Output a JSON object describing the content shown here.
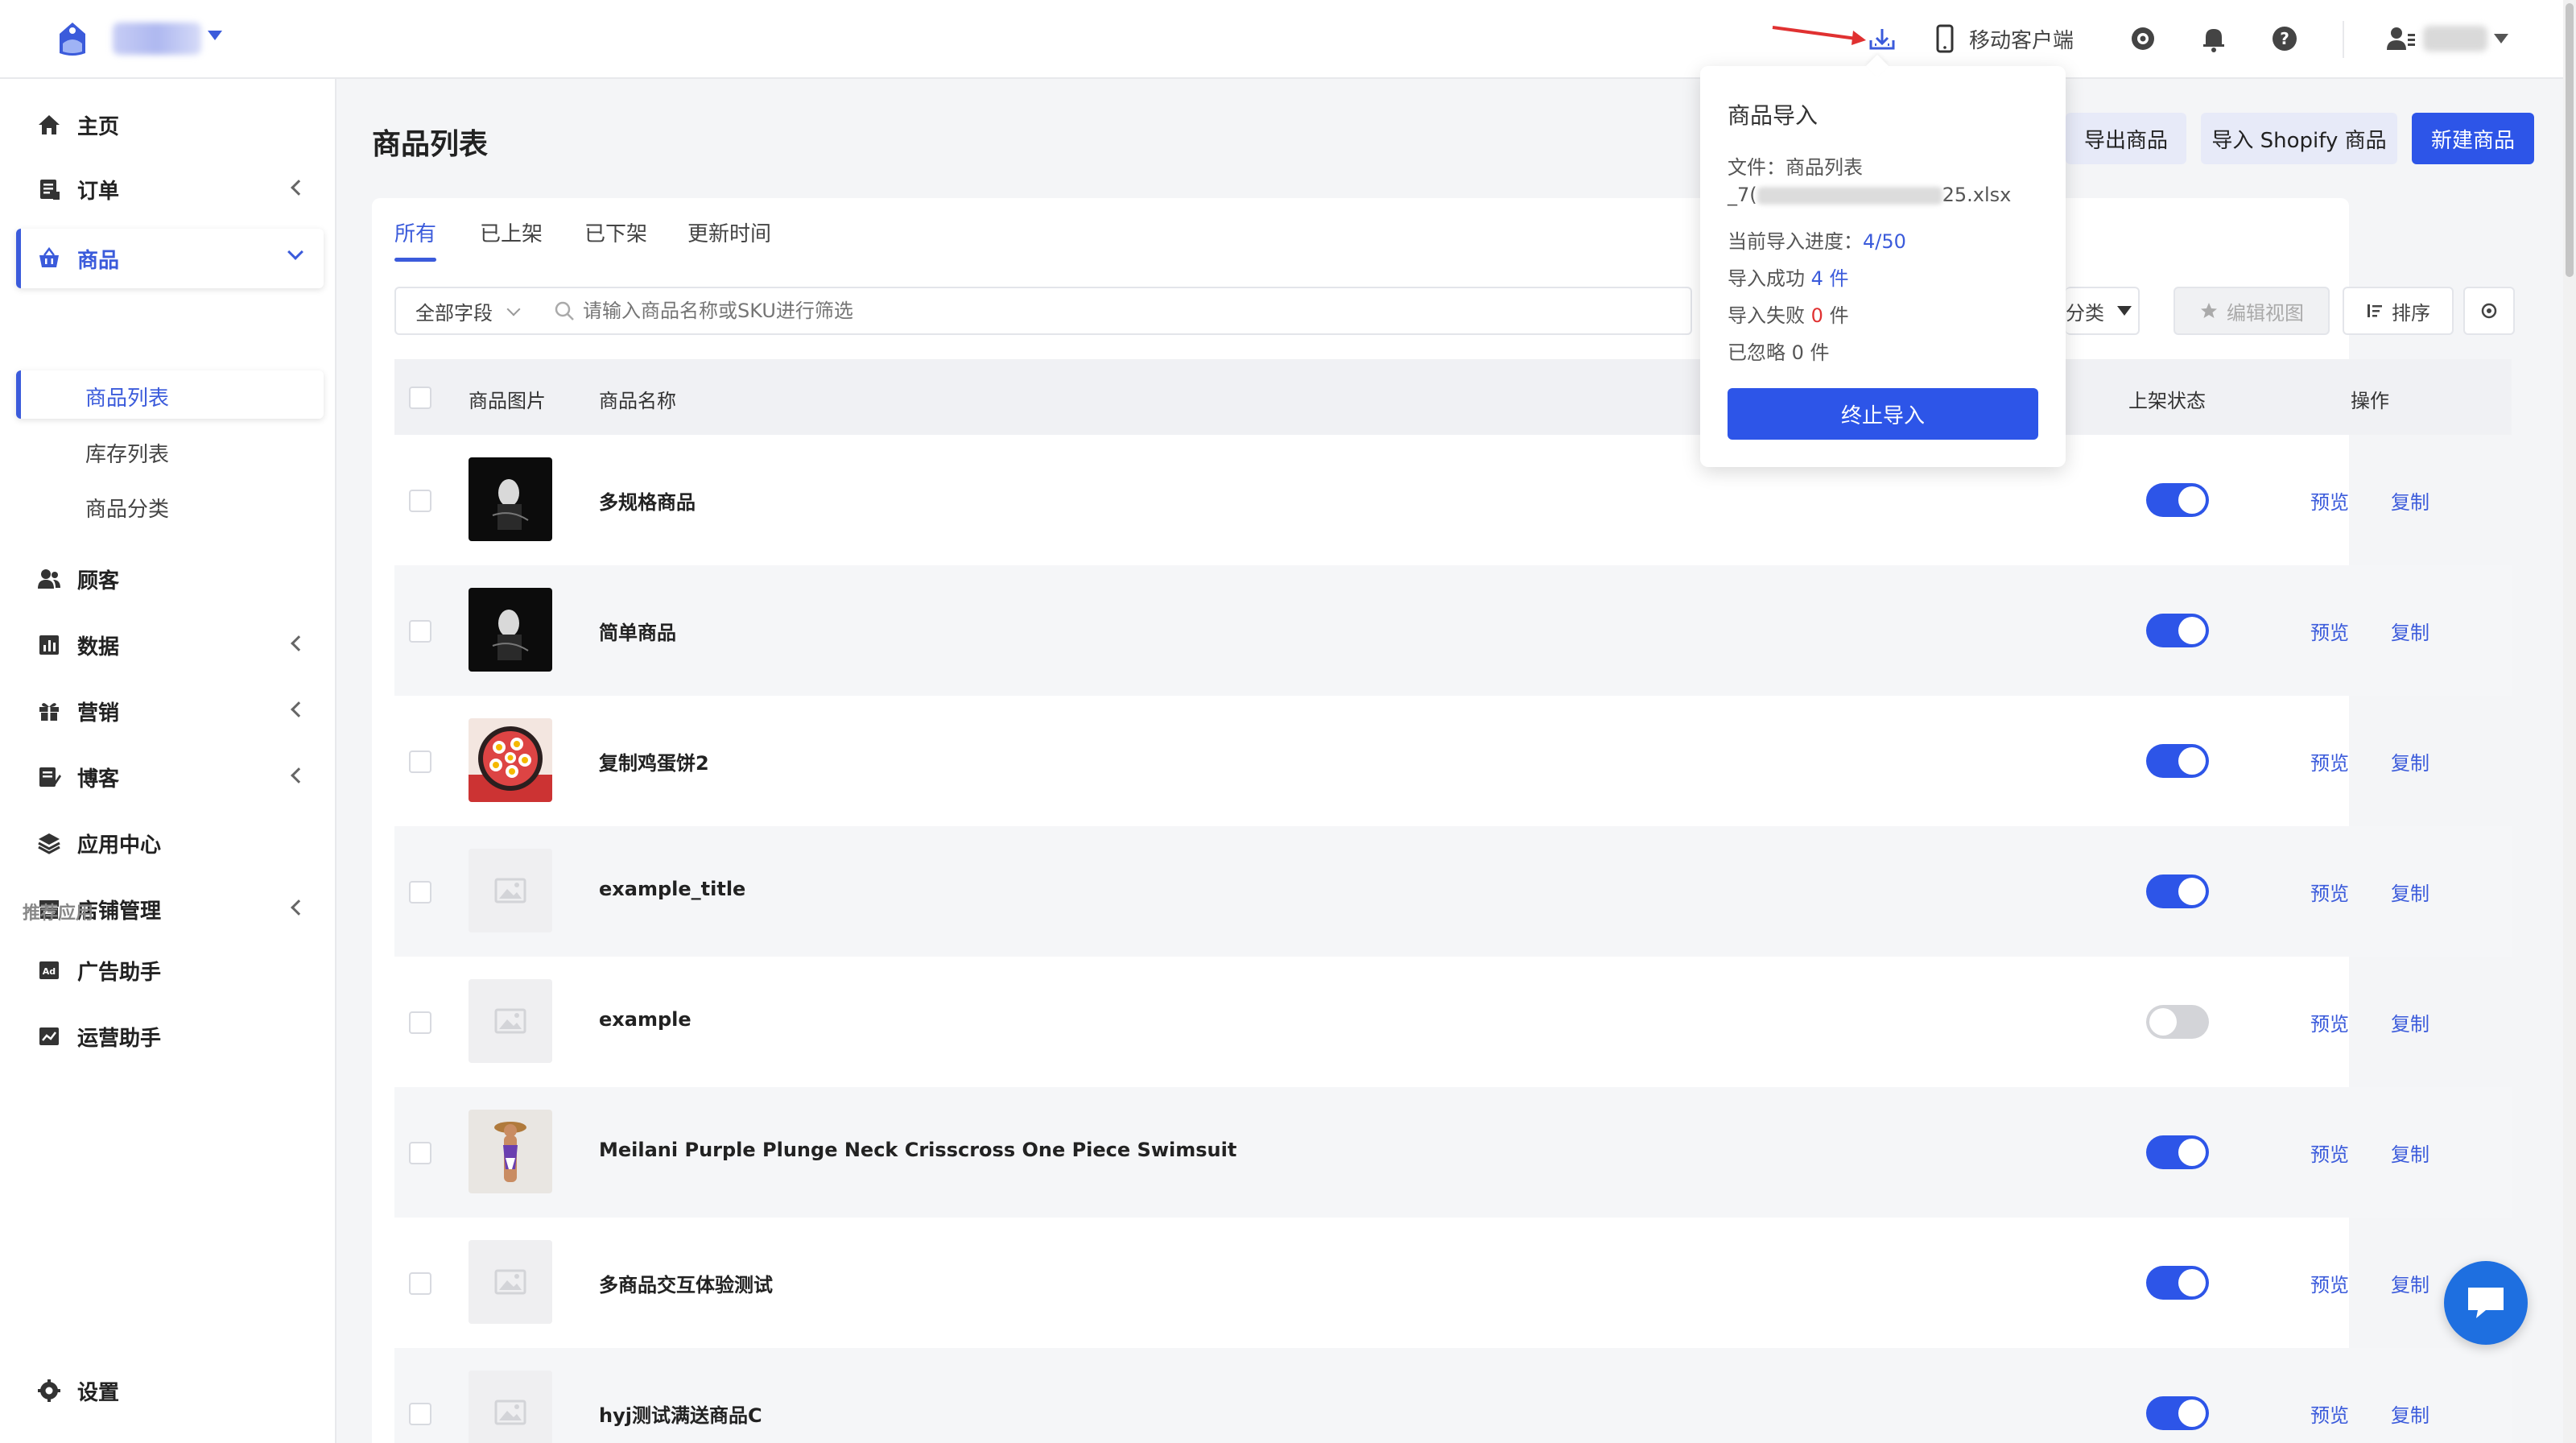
{
  "topbar": {
    "mobile_client_label": "移动客户端"
  },
  "sidebar": {
    "items": [
      {
        "label": "主页",
        "icon": "home-icon"
      },
      {
        "label": "订单",
        "icon": "order-icon"
      },
      {
        "label": "商品",
        "icon": "basket-icon"
      },
      {
        "label": "顾客",
        "icon": "customers-icon"
      },
      {
        "label": "数据",
        "icon": "chart-icon"
      },
      {
        "label": "营销",
        "icon": "gift-icon"
      },
      {
        "label": "博客",
        "icon": "blog-icon"
      },
      {
        "label": "应用中心",
        "icon": "layers-icon"
      },
      {
        "label": "店铺管理",
        "icon": "store-icon"
      }
    ],
    "sub_items": [
      "商品列表",
      "库存列表",
      "商品分类"
    ],
    "section_label": "推荐应用",
    "apps": [
      {
        "label": "广告助手",
        "icon": "ad-icon"
      },
      {
        "label": "运营助手",
        "icon": "trend-icon"
      }
    ],
    "settings_label": "设置"
  },
  "main": {
    "title": "商品列表",
    "buttons": {
      "export": "导出商品",
      "import_shopify": "导入 Shopify 商品",
      "new_product": "新建商品"
    },
    "tabs": [
      "所有",
      "已上架",
      "已下架",
      "更新时间"
    ],
    "filter": {
      "field_select": "全部字段",
      "search_placeholder": "请输入商品名称或SKU进行筛选",
      "category_partial": "分类",
      "edit_view": "编辑视图",
      "sort": "排序"
    },
    "table": {
      "headers": [
        "商品图片",
        "商品名称",
        "上架状态",
        "操作"
      ],
      "op_preview": "预览",
      "op_copy": "复制",
      "rows": [
        {
          "name": "多规格商品",
          "listed": true
        },
        {
          "name": "简单商品",
          "listed": true
        },
        {
          "name": "复制鸡蛋饼2",
          "listed": true
        },
        {
          "name": "example_title",
          "listed": true
        },
        {
          "name": "example",
          "listed": false
        },
        {
          "name": "Meilani Purple Plunge Neck Crisscross One Piece Swimsuit",
          "listed": true
        },
        {
          "name": "多商品交互体验测试",
          "listed": true
        },
        {
          "name": "hyj测试满送商品C",
          "listed": true
        }
      ]
    }
  },
  "import_popover": {
    "title": "商品导入",
    "file_label": "文件：商品列表",
    "file_name_start": "_7(",
    "file_name_end": "25.xlsx",
    "progress_label": "当前导入进度：",
    "progress_value": "4/50",
    "success_label": "导入成功",
    "success_count": "4 件",
    "failed_label": "导入失败",
    "failed_count": "0",
    "failed_unit": "件",
    "ignored_label": "已忽略",
    "ignored_count": "0 件",
    "stop_button": "终止导入"
  },
  "colors": {
    "accent": "#2d55e8",
    "link": "#3b5bdb",
    "danger": "#e03131"
  }
}
